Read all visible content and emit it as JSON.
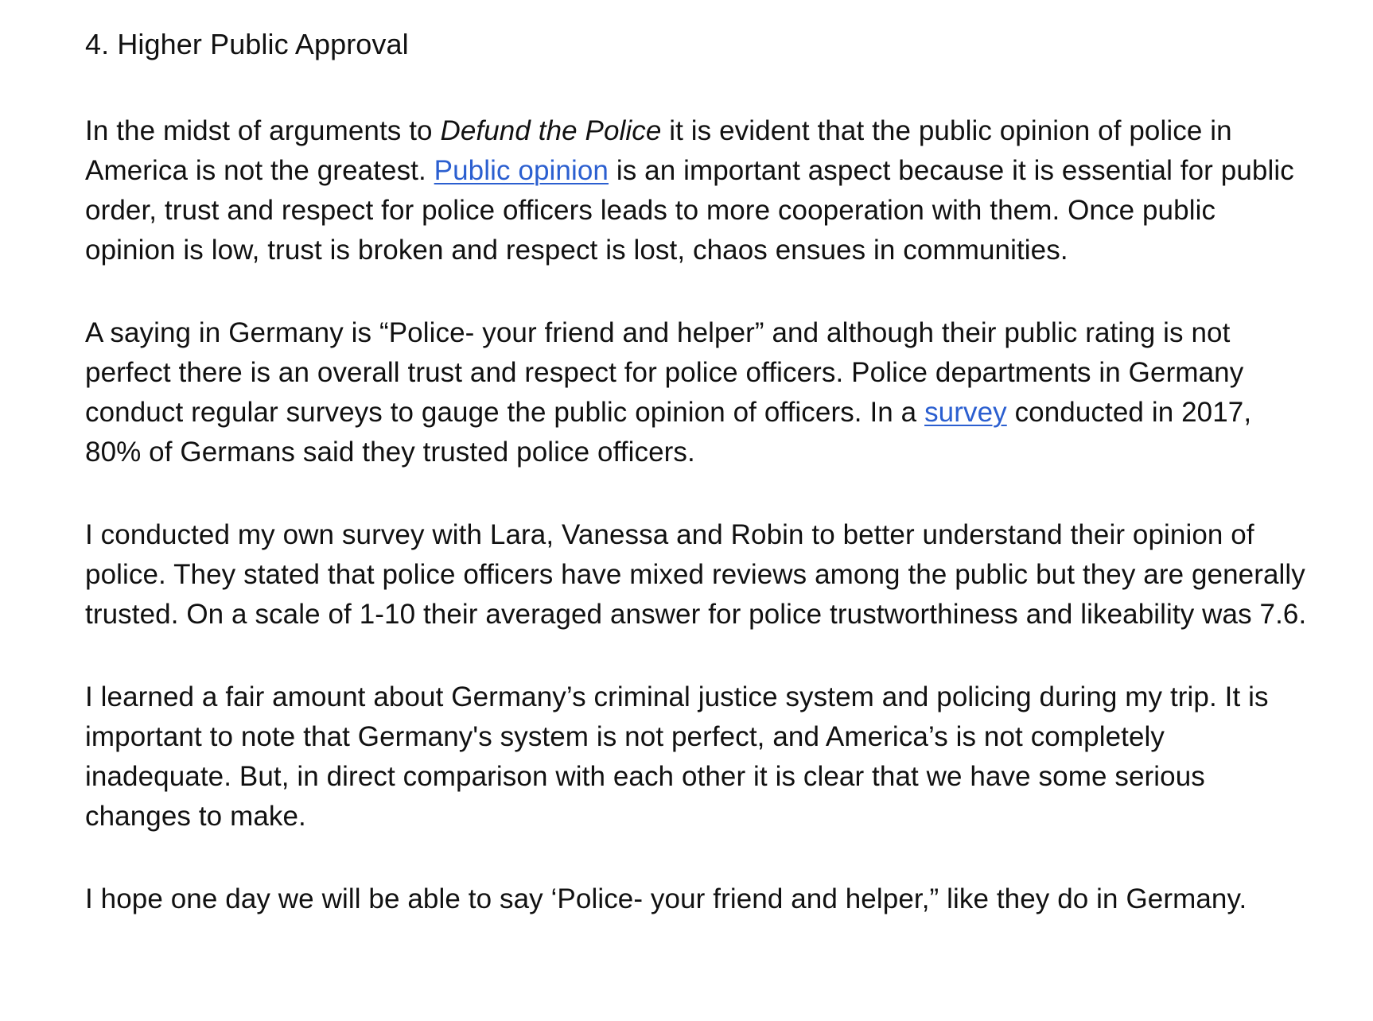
{
  "heading": "4. Higher Public Approval",
  "p1": {
    "before_italic": "In the midst of arguments to ",
    "italic": "Defund the Police",
    "after_italic": " it is evident that the public opinion of police in America is not the greatest. ",
    "link": "Public opinion",
    "after_link": " is an important aspect because it is essential for public order, trust and respect for police officers leads to more cooperation with them. Once public opinion is low, trust is broken and respect is lost, chaos ensues in communities."
  },
  "p2": {
    "before_link": "A saying in Germany is “Police- your friend and helper” and although their public rating is not perfect there is an overall trust and respect for police officers. Police departments in Germany conduct regular surveys to gauge the public opinion of officers. In a ",
    "link": "survey",
    "after_link": " conducted in 2017, 80% of Germans said they trusted police officers."
  },
  "p3": "I conducted my own survey with Lara, Vanessa and Robin to better understand their opinion of police. They stated that police officers have mixed reviews among the public but they are generally trusted. On a scale of 1-10 their averaged answer for police trustworthiness and likeability was 7.6.",
  "p4": "I learned a fair amount about Germany’s criminal justice system and policing during my trip. It is important to note that Germany's system is not perfect, and America’s is not completely inadequate. But, in direct comparison with each other it is clear that we have some serious changes to make.",
  "p5": "I hope one day we will be able to say ‘Police- your friend and helper,” like they do in Germany.",
  "colors": {
    "text": "#111111",
    "link": "#2b5fd0",
    "background": "#ffffff"
  }
}
